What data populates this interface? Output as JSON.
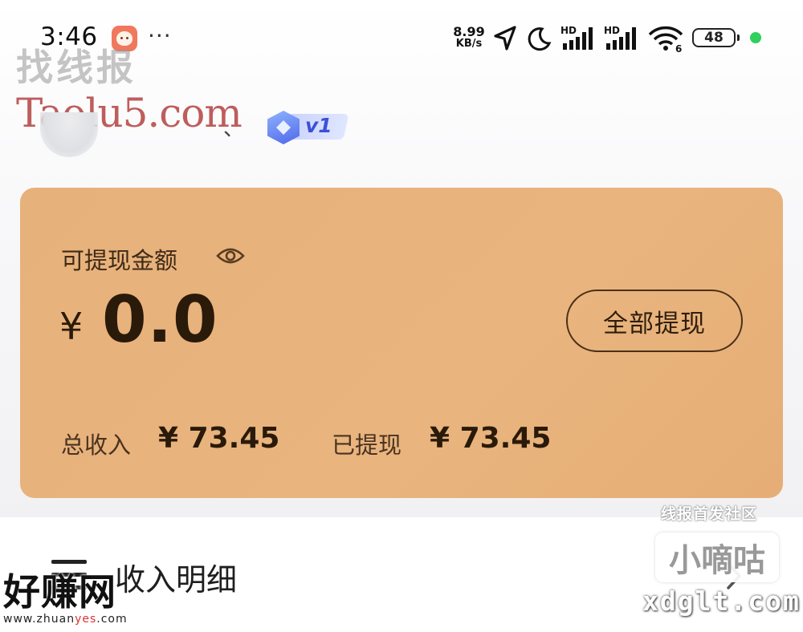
{
  "status_bar": {
    "time": "3:46",
    "more": "···",
    "net_speed_value": "8.99",
    "net_speed_unit": "KB/s",
    "hd_label": "HD",
    "wifi_label": "6",
    "battery": "48",
    "icons": [
      "app-icon",
      "location-arrow-icon",
      "moon-icon",
      "signal-hd-icon",
      "signal-hd-icon",
      "wifi-6-icon",
      "battery-icon"
    ]
  },
  "watermark": {
    "top_cn": "找线报",
    "top_en": "Taolu5.com",
    "left_big": "好赚网",
    "left_small_a": "www.zhuan",
    "left_small_b": "yes",
    "left_small_c": ".com",
    "right_top": "线报首发社区",
    "right_box": "小嘀咕",
    "right_url": "xdglt.com"
  },
  "profile": {
    "username_visible": "、",
    "vip_level": "v1"
  },
  "balance_card": {
    "label": "可提现金额",
    "currency": "¥",
    "amount": "0.0",
    "withdraw_all_button": "全部提现",
    "total_income_label": "总收入",
    "total_income_value": "¥ 73.45",
    "withdrawn_label": "已提现",
    "withdrawn_value": "¥ 73.45"
  },
  "income_detail": {
    "title": "收入明细"
  },
  "colors": {
    "card_bg": "#e8b27c",
    "text_dark": "#2a1a09",
    "vip_blue": "#3b51d8",
    "charge_green": "#2fd05b"
  }
}
